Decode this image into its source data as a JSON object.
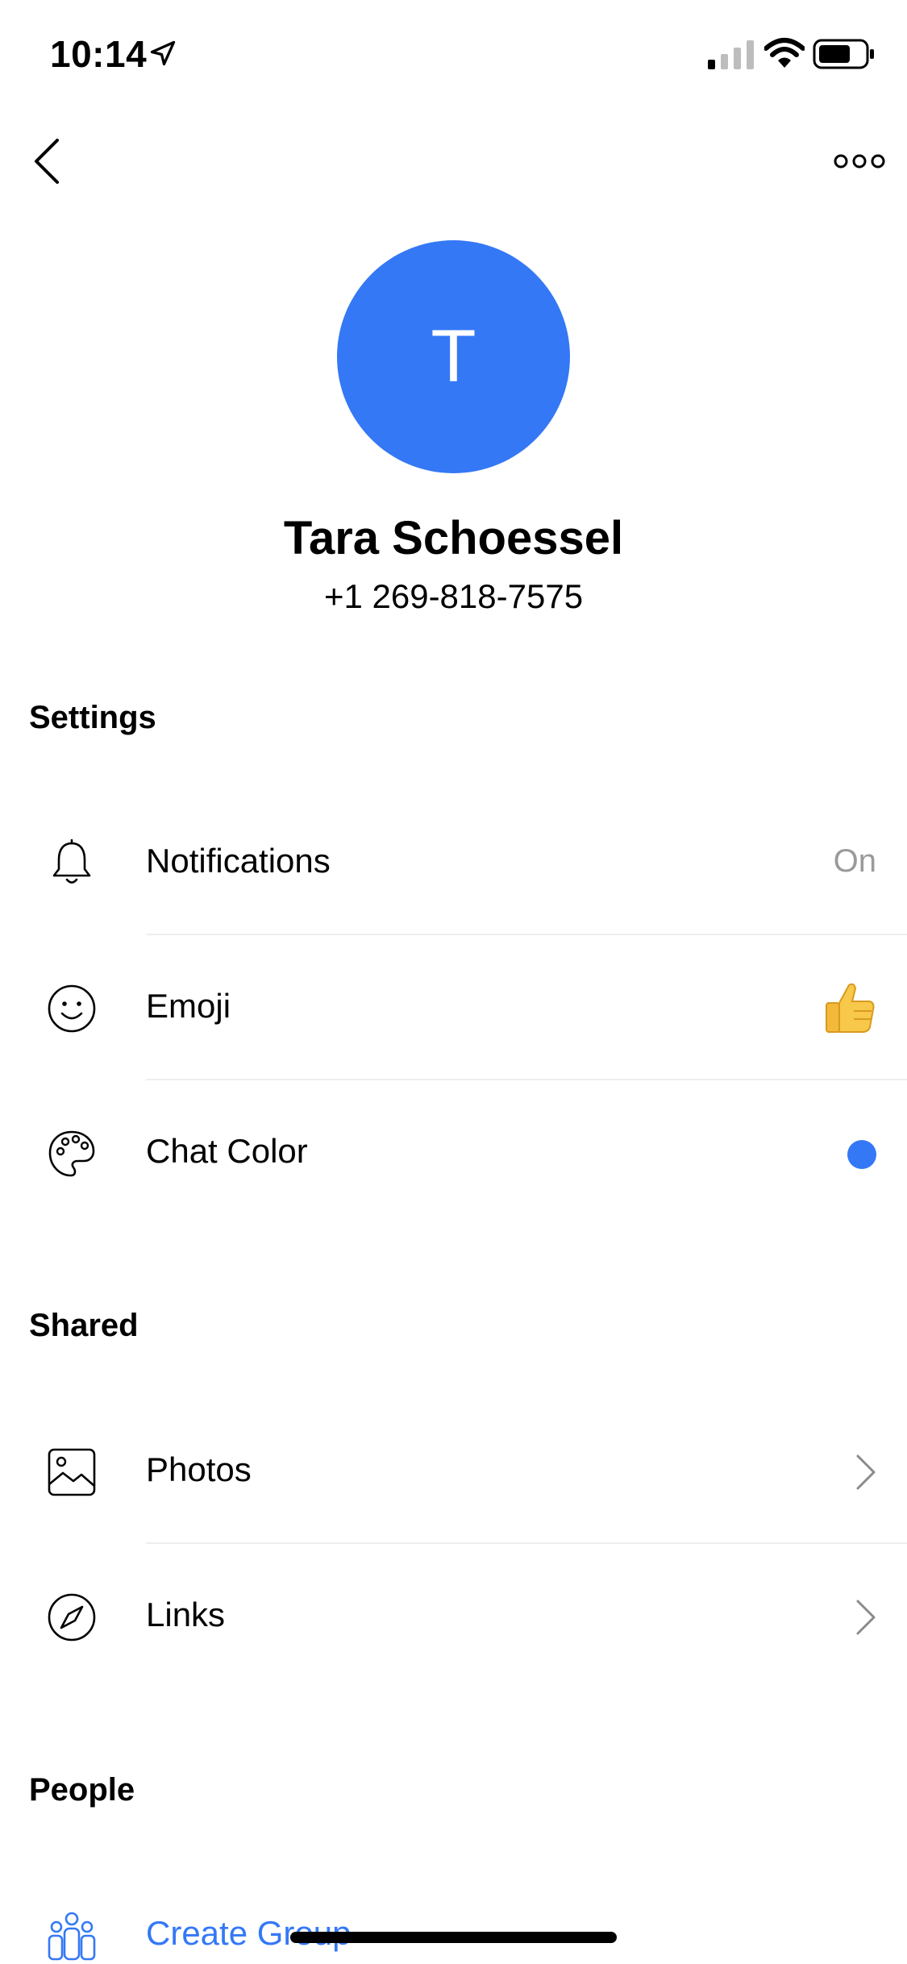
{
  "status_bar": {
    "time": "10:14"
  },
  "profile": {
    "avatar_initial": "T",
    "avatar_color": "#3478f6",
    "name": "Tara Schoessel",
    "phone": "+1 269-818-7575"
  },
  "sections": {
    "settings": {
      "header": "Settings",
      "notifications": {
        "label": "Notifications",
        "value": "On",
        "icon": "bell-icon"
      },
      "emoji": {
        "label": "Emoji",
        "value_icon": "thumbs-up-emoji",
        "icon": "smiley-icon"
      },
      "chat_color": {
        "label": "Chat Color",
        "color": "#3478f6",
        "icon": "palette-icon"
      }
    },
    "shared": {
      "header": "Shared",
      "photos": {
        "label": "Photos",
        "icon": "photo-icon"
      },
      "links": {
        "label": "Links",
        "icon": "compass-icon"
      }
    },
    "people": {
      "header": "People",
      "create_group": {
        "label": "Create Group",
        "icon": "people-group-icon",
        "color": "#3478f6"
      }
    }
  }
}
